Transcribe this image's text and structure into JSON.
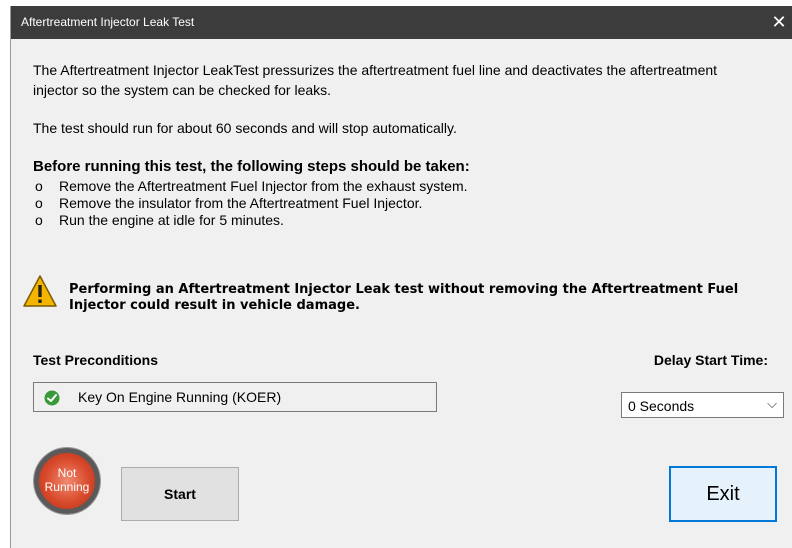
{
  "window": {
    "title": "Aftertreatment Injector Leak Test",
    "close_glyph": "✕"
  },
  "content": {
    "description": "The Aftertreatment Injector LeakTest pressurizes the aftertreatment fuel line and deactivates the aftertreatment injector so the system can be checked for leaks.",
    "run_info": "The test should run for about 60 seconds and will stop automatically.",
    "steps_title": "Before running this test, the following steps should be taken:",
    "steps": [
      {
        "bullet": "o",
        "text": "Remove the Aftertreatment Fuel Injector from the exhaust system."
      },
      {
        "bullet": "o",
        "text": "Remove the insulator from the Aftertreatment Fuel Injector."
      },
      {
        "bullet": "o",
        "text": "Run the engine at idle for 5 minutes."
      }
    ]
  },
  "warning": {
    "icon": "warning-triangle-icon",
    "text": "Performing an Aftertreatment Injector Leak test without removing the Aftertreatment Fuel Injector could result in vehicle damage."
  },
  "preconditions": {
    "label": "Test Preconditions",
    "item_icon": "check-circle-icon",
    "item": "Key On Engine Running (KOER)"
  },
  "delay": {
    "label": "Delay Start Time:",
    "selected": "0 Seconds"
  },
  "status": {
    "line1": "Not",
    "line2": "Running",
    "color": "#d94a2c"
  },
  "buttons": {
    "start": "Start",
    "exit": "Exit"
  }
}
